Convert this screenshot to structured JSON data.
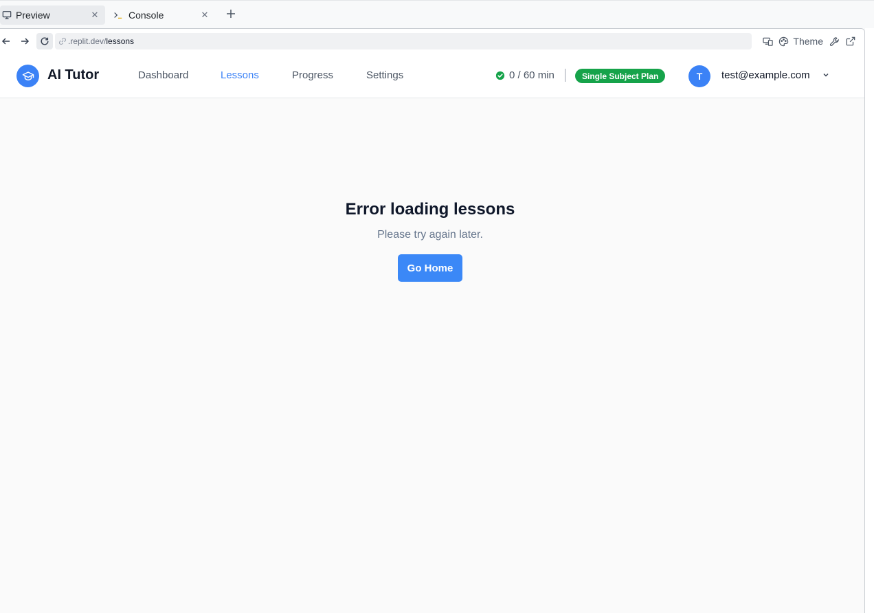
{
  "tabs": [
    {
      "label": "Preview",
      "icon": "monitor-icon",
      "active": true
    },
    {
      "label": "Console",
      "icon": "terminal-icon",
      "active": false
    }
  ],
  "addressbar": {
    "url_host": ".replit.dev/",
    "url_path": "lessons",
    "theme_label": "Theme"
  },
  "header": {
    "brand": "AI Tutor",
    "nav": [
      {
        "label": "Dashboard",
        "active": false
      },
      {
        "label": "Lessons",
        "active": true
      },
      {
        "label": "Progress",
        "active": false
      },
      {
        "label": "Settings",
        "active": false
      }
    ],
    "usage": "0 / 60 min",
    "plan": "Single Subject Plan",
    "avatar_initial": "T",
    "email": "test@example.com"
  },
  "main": {
    "title": "Error loading lessons",
    "message": "Please try again later.",
    "button": "Go Home"
  },
  "colors": {
    "accent": "#3b82f6",
    "success": "#16a34a",
    "background": "#fafafa"
  }
}
